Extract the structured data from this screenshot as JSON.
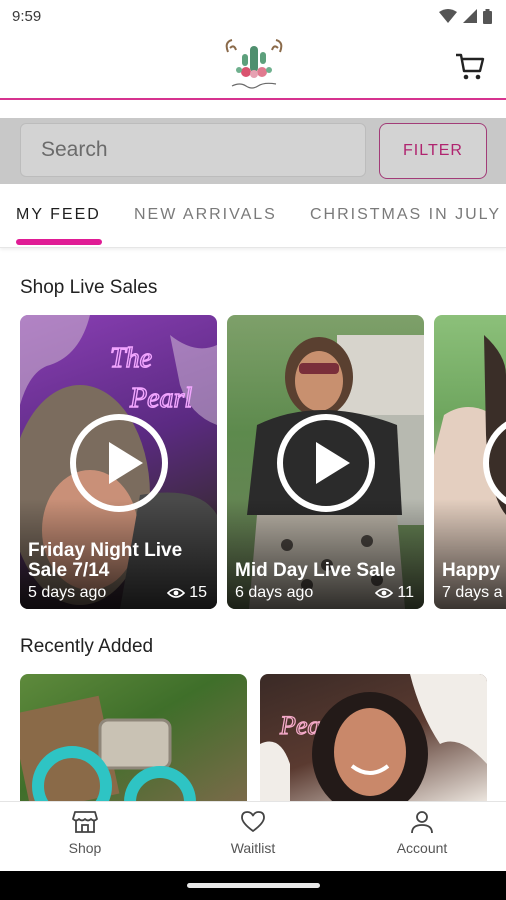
{
  "status_bar": {
    "time": "9:59"
  },
  "header": {
    "logo_alt": "the cactus pearl",
    "cart_icon": "cart-icon"
  },
  "search": {
    "placeholder": "Search",
    "filter_label": "FILTER"
  },
  "tabs": [
    {
      "label": "MY FEED",
      "active": true
    },
    {
      "label": "NEW ARRIVALS",
      "active": false
    },
    {
      "label": "CHRISTMAS IN JULY",
      "active": false
    }
  ],
  "live_sales": {
    "title": "Shop Live Sales",
    "items": [
      {
        "title": "Friday Night Live Sale 7/14",
        "age": "5 days ago",
        "views": "15"
      },
      {
        "title": "Mid Day Live Sale",
        "age": "6 days ago",
        "views": "11"
      },
      {
        "title": "Happy",
        "age": "7 days a",
        "views": ""
      }
    ]
  },
  "recently_added": {
    "title": "Recently Added"
  },
  "bottom_nav": [
    {
      "label": "Shop",
      "icon": "storefront-icon"
    },
    {
      "label": "Waitlist",
      "icon": "heart-icon"
    },
    {
      "label": "Account",
      "icon": "person-icon"
    }
  ],
  "colors": {
    "accent": "#e01c95",
    "filter_border": "#a23c78",
    "filter_text": "#b0246f"
  }
}
